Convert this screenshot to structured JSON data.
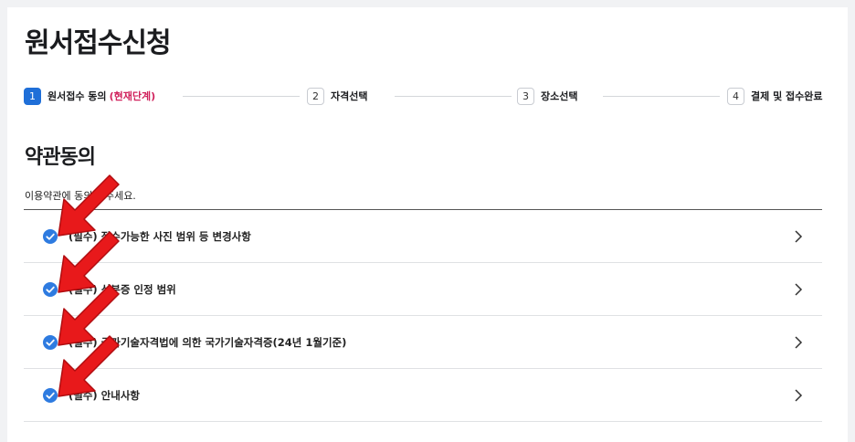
{
  "page_title": "원서접수신청",
  "steps": [
    {
      "num": "1",
      "label": "원서접수 동의",
      "current": "(현재단계)"
    },
    {
      "num": "2",
      "label": "자격선택"
    },
    {
      "num": "3",
      "label": "장소선택"
    },
    {
      "num": "4",
      "label": "결제 및 접수완료"
    }
  ],
  "section": {
    "title": "약관동의",
    "description": "이용약관에 동의해 주세요."
  },
  "terms": [
    {
      "label": "(필수) 접수가능한 사진 범위 등 변경사항",
      "checked": true
    },
    {
      "label": "(필수) 신분증 인정 범위",
      "checked": true
    },
    {
      "label": "(필수) 국가기술자격법에 의한 국가기술자격증(24년 1월기준)",
      "checked": true
    },
    {
      "label": "(필수) 안내사항",
      "checked": true
    }
  ],
  "colors": {
    "accent": "#1f6fd8",
    "current_step": "#d0215c",
    "check": "#2e7be0",
    "annotation_arrow": "#e8191b"
  },
  "icons": {
    "check": "check-circle-icon",
    "chevron": "chevron-right-icon",
    "annotation": "red-arrow-annotation-icon"
  }
}
